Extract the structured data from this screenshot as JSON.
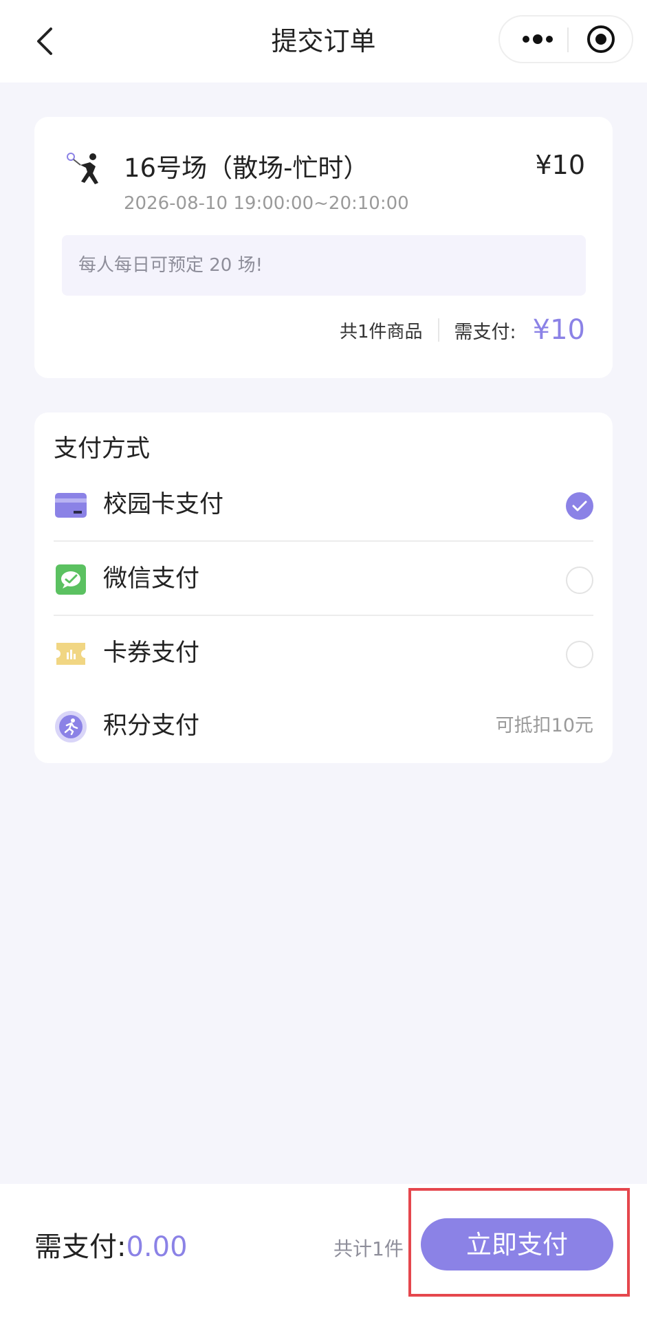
{
  "nav": {
    "title": "提交订单",
    "back_icon": "back-arrow-icon",
    "more_icon": "more-dots-icon",
    "close_icon": "target-icon"
  },
  "order": {
    "venue": "16号场（散场-忙时）",
    "price": "¥10",
    "time": "2026-08-10 19:00:00~20:10:00",
    "notice": "每人每日可预定 20 场!",
    "item_count": "共1件商品",
    "need_pay_label": "需支付:",
    "need_pay_amount": "¥10",
    "icon": "tennis-player-icon"
  },
  "payment": {
    "title": "支付方式",
    "methods": [
      {
        "label": "校园卡支付",
        "icon": "campus-card-icon",
        "selected": true
      },
      {
        "label": "微信支付",
        "icon": "wechat-pay-icon",
        "selected": false
      },
      {
        "label": "卡券支付",
        "icon": "coupon-icon",
        "selected": false
      },
      {
        "label": "积分支付",
        "icon": "points-icon",
        "hint": "可抵扣10元"
      }
    ]
  },
  "footer": {
    "need_pay_label": "需支付:",
    "need_pay_value": "0.00",
    "total_count": "共计1件",
    "pay_button": "立即支付"
  },
  "colors": {
    "accent": "#8b82e6",
    "background": "#f5f5fb",
    "highlight": "#e5474d"
  }
}
